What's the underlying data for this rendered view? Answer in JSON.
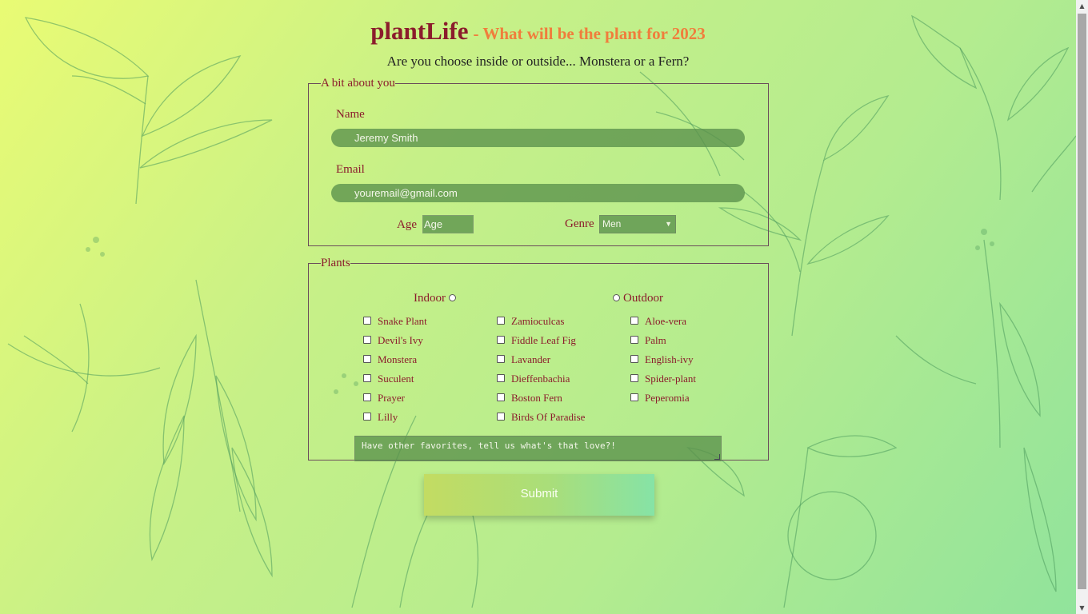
{
  "header": {
    "brand": "plantLife",
    "tagline": "- What will be the plant for 2023",
    "subtitle": "Are you choose inside or outside... Monstera or a Fern?"
  },
  "about": {
    "legend": "A bit about you",
    "name_label": "Name",
    "name_value": "Jeremy Smith",
    "email_label": "Email",
    "email_value": "youremail@gmail.com",
    "age_label": "Age",
    "age_placeholder": "Age",
    "genre_label": "Genre",
    "genre_selected": "Men"
  },
  "plants": {
    "legend": "Plants",
    "indoor_label": "Indoor",
    "outdoor_label": "Outdoor",
    "options": [
      "Snake Plant",
      "Zamioculcas",
      "Aloe-vera",
      "Devil's Ivy",
      "Fiddle Leaf Fig",
      "Palm",
      "Monstera",
      "Lavander",
      "English-ivy",
      "Suculent",
      "Dieffenbachia",
      "Spider-plant",
      "Prayer",
      "Boston Fern",
      "Peperomia",
      "Lilly",
      "Birds Of Paradise"
    ],
    "other_placeholder": "Have other favorites, tell us what's that love?!"
  },
  "submit_label": "Submit",
  "colors": {
    "brand": "#8b1c2c",
    "tagline": "#f07d3c",
    "field_bg": "#5a914b",
    "gradient_start": "#e9fb74",
    "gradient_end": "#90e39c"
  }
}
